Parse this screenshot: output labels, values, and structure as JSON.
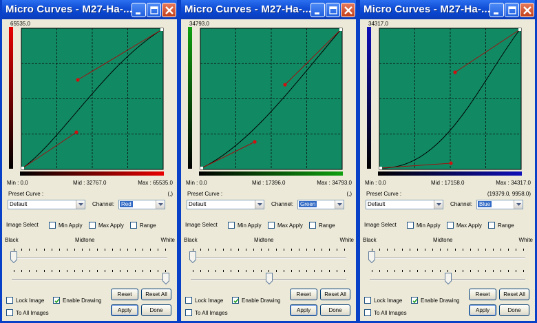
{
  "common": {
    "preset_label": "Preset Curve :",
    "channel_label": "Channel:",
    "preset_value": "Default",
    "image_select_label": "Image Select",
    "min_apply": "Min Apply",
    "max_apply": "Max Apply",
    "range": "Range",
    "black": "Black",
    "midtone": "Midtone",
    "white": "White",
    "lock_image": "Lock Image",
    "enable_drawing": "Enable Drawing",
    "to_all_images": "To All Images",
    "reset": "Reset",
    "reset_all": "Reset All",
    "apply": "Apply",
    "done": "Done"
  },
  "windows": [
    {
      "title": "Micro Curves - M27-Ha-...",
      "max_value": "65535.0",
      "min_text": "Min :  0.0",
      "mid_text": "Mid :  32767.0",
      "max_text": "Max :  65535.0",
      "coords": "(,)",
      "channel": "Red",
      "channel_color": "#e80000",
      "min_apply": false,
      "max_apply": false,
      "range": false,
      "lock_image": false,
      "enable_drawing": true,
      "to_all_images": false,
      "slider_top": 0.0,
      "slider_bottom": 1.0
    },
    {
      "title": "Micro Curves - M27-Ha-...",
      "max_value": "34793.0",
      "min_text": "Min :  0.0",
      "mid_text": "Mid :  17396.0",
      "max_text": "Max :  34793.0",
      "coords": "(,)",
      "channel": "Green",
      "channel_color": "#10a010",
      "min_apply": false,
      "max_apply": false,
      "range": false,
      "lock_image": false,
      "enable_drawing": true,
      "to_all_images": false,
      "slider_top": 0.0,
      "slider_bottom": 0.5
    },
    {
      "title": "Micro Curves - M27-Ha-...",
      "max_value": "34317.0",
      "min_text": "Min :  0.0",
      "mid_text": "Mid :  17158.0",
      "max_text": "Max :  34317.0",
      "coords": "(19379.0, 9958.0)",
      "channel": "Blue",
      "channel_color": "#1010b8",
      "min_apply": false,
      "max_apply": false,
      "range": false,
      "lock_image": false,
      "enable_drawing": true,
      "to_all_images": false,
      "slider_top": 0.0,
      "slider_bottom": 0.5
    }
  ]
}
